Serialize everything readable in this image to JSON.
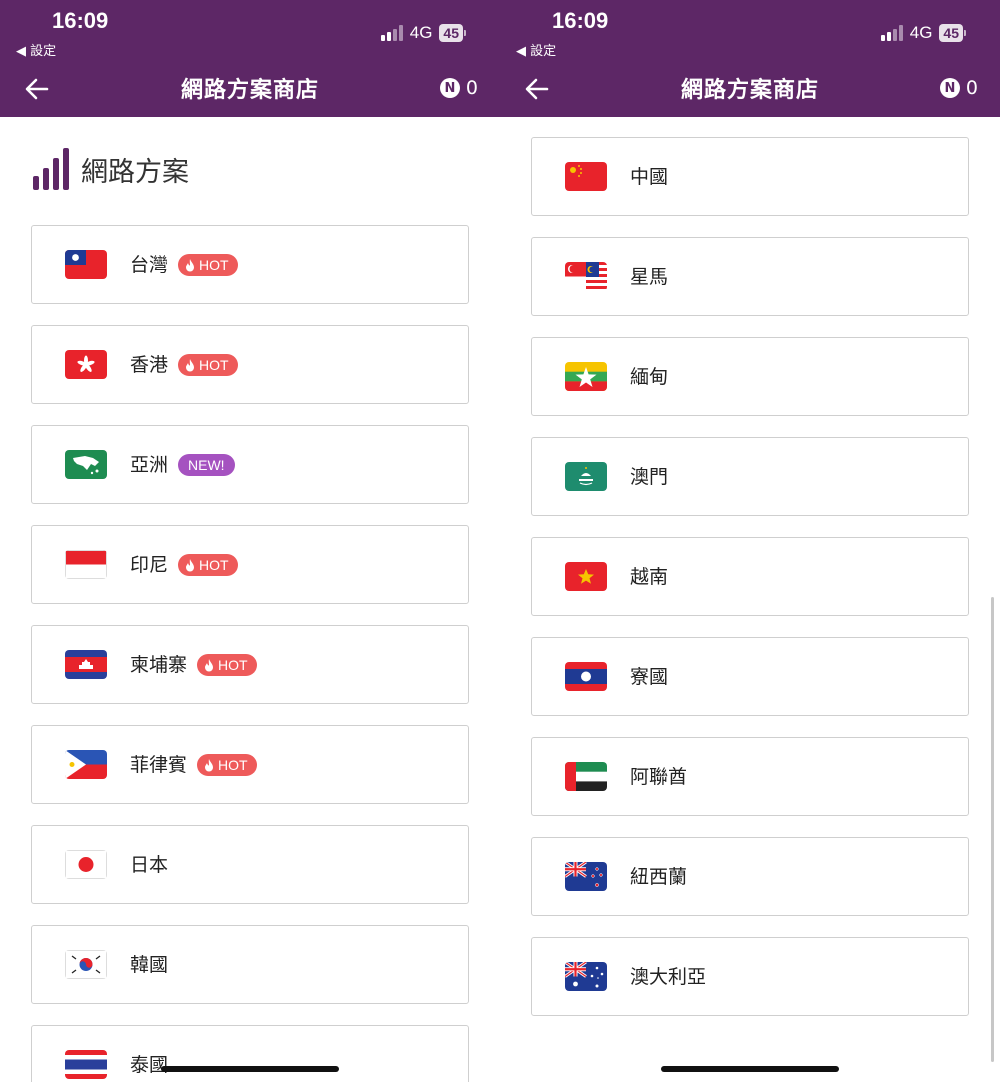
{
  "status": {
    "time": "16:09",
    "back_app": "◀ 設定",
    "network": "4G",
    "battery": "45"
  },
  "nav": {
    "title": "網路方案商店",
    "points": "0",
    "coin": "N"
  },
  "section": {
    "title": "網路方案"
  },
  "left_list": [
    {
      "name": "台灣",
      "badge": "HOT",
      "badge_type": "hot",
      "flag": "taiwan"
    },
    {
      "name": "香港",
      "badge": "HOT",
      "badge_type": "hot",
      "flag": "hongkong"
    },
    {
      "name": "亞洲",
      "badge": "NEW!",
      "badge_type": "new",
      "flag": "asia"
    },
    {
      "name": "印尼",
      "badge": "HOT",
      "badge_type": "hot",
      "flag": "indonesia"
    },
    {
      "name": "柬埔寨",
      "badge": "HOT",
      "badge_type": "hot",
      "flag": "cambodia"
    },
    {
      "name": "菲律賓",
      "badge": "HOT",
      "badge_type": "hot",
      "flag": "philippines"
    },
    {
      "name": "日本",
      "badge": "",
      "badge_type": "",
      "flag": "japan"
    },
    {
      "name": "韓國",
      "badge": "",
      "badge_type": "",
      "flag": "korea"
    },
    {
      "name": "泰國",
      "badge": "",
      "badge_type": "",
      "flag": "thailand"
    }
  ],
  "right_list": [
    {
      "name": "中國",
      "flag": "china"
    },
    {
      "name": "星馬",
      "flag": "sgmy"
    },
    {
      "name": "緬甸",
      "flag": "myanmar"
    },
    {
      "name": "澳門",
      "flag": "macau"
    },
    {
      "name": "越南",
      "flag": "vietnam"
    },
    {
      "name": "寮國",
      "flag": "laos"
    },
    {
      "name": "阿聯酋",
      "flag": "uae"
    },
    {
      "name": "紐西蘭",
      "flag": "newzealand"
    },
    {
      "name": "澳大利亞",
      "flag": "australia"
    }
  ],
  "colors": {
    "brand": "#5d2766",
    "hot": "#ee5a5a",
    "new": "#a552c0"
  }
}
